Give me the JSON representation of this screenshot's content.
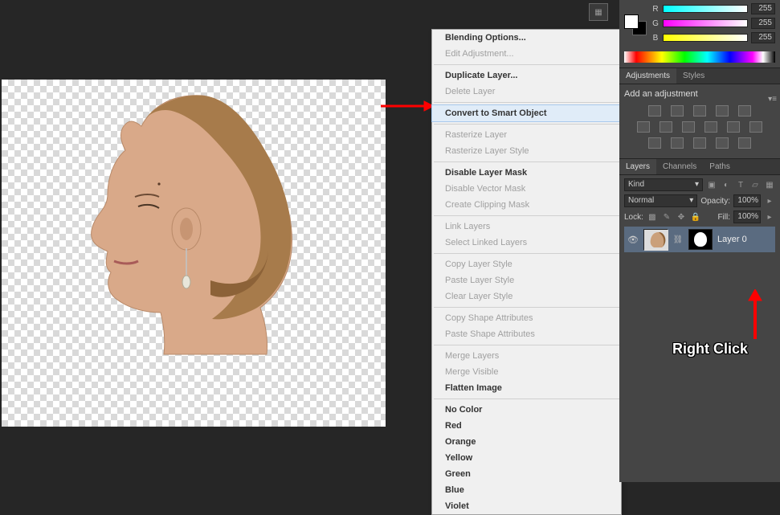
{
  "context_menu": {
    "items": [
      {
        "label": "Blending Options...",
        "bold": true
      },
      {
        "label": "Edit Adjustment...",
        "disabled": true
      },
      {
        "sep": true
      },
      {
        "label": "Duplicate Layer...",
        "bold": true
      },
      {
        "label": "Delete Layer",
        "disabled": true
      },
      {
        "sep": true
      },
      {
        "label": "Convert to Smart Object",
        "hover": true,
        "bold": true
      },
      {
        "sep": true
      },
      {
        "label": "Rasterize Layer",
        "disabled": true
      },
      {
        "label": "Rasterize Layer Style",
        "disabled": true
      },
      {
        "sep": true
      },
      {
        "label": "Disable Layer Mask",
        "bold": true
      },
      {
        "label": "Disable Vector Mask",
        "disabled": true
      },
      {
        "label": "Create Clipping Mask",
        "disabled": true
      },
      {
        "sep": true
      },
      {
        "label": "Link Layers",
        "disabled": true
      },
      {
        "label": "Select Linked Layers",
        "disabled": true
      },
      {
        "sep": true
      },
      {
        "label": "Copy Layer Style",
        "disabled": true
      },
      {
        "label": "Paste Layer Style",
        "disabled": true
      },
      {
        "label": "Clear Layer Style",
        "disabled": true
      },
      {
        "sep": true
      },
      {
        "label": "Copy Shape Attributes",
        "disabled": true
      },
      {
        "label": "Paste Shape Attributes",
        "disabled": true
      },
      {
        "sep": true
      },
      {
        "label": "Merge Layers",
        "disabled": true
      },
      {
        "label": "Merge Visible",
        "disabled": true
      },
      {
        "label": "Flatten Image",
        "bold": true
      },
      {
        "sep": true
      },
      {
        "label": "No Color",
        "bold": true
      },
      {
        "label": "Red",
        "bold": true
      },
      {
        "label": "Orange",
        "bold": true
      },
      {
        "label": "Yellow",
        "bold": true
      },
      {
        "label": "Green",
        "bold": true
      },
      {
        "label": "Blue",
        "bold": true
      },
      {
        "label": "Violet",
        "bold": true
      }
    ]
  },
  "color": {
    "r_label": "R",
    "g_label": "G",
    "b_label": "B",
    "r_value": "255",
    "g_value": "255",
    "b_value": "255"
  },
  "adjustments": {
    "tab_adjustments": "Adjustments",
    "tab_styles": "Styles",
    "title": "Add an adjustment"
  },
  "layers": {
    "tab_layers": "Layers",
    "tab_channels": "Channels",
    "tab_paths": "Paths",
    "kind_label": "Kind",
    "blend_mode": "Normal",
    "opacity_label": "Opacity:",
    "opacity_value": "100%",
    "lock_label": "Lock:",
    "fill_label": "Fill:",
    "fill_value": "100%",
    "layer0_name": "Layer 0"
  },
  "annotation": {
    "right_click": "Right Click"
  }
}
